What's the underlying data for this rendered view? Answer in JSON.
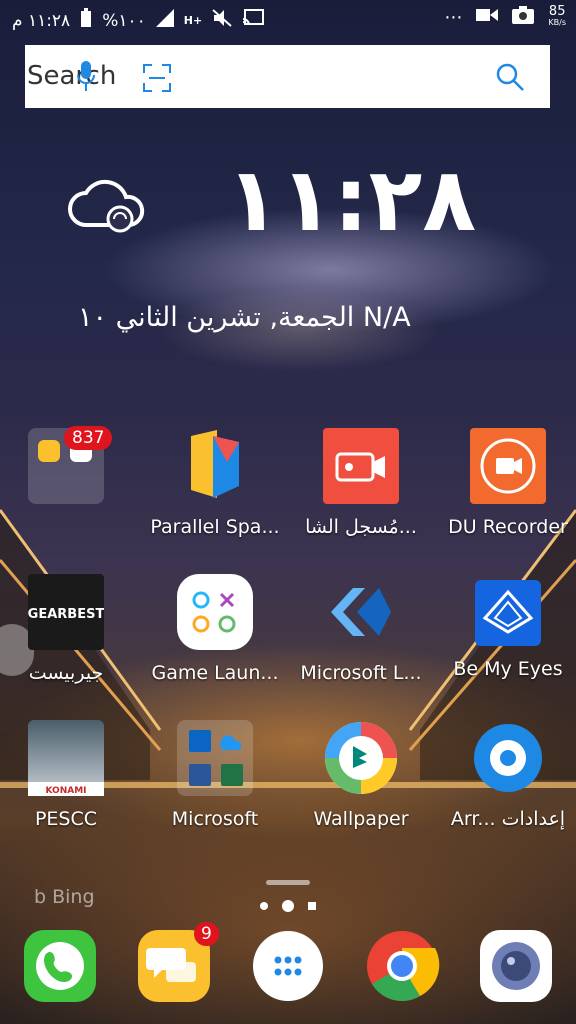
{
  "status_bar": {
    "time": "١١:٢٨ م",
    "battery": "%١٠٠",
    "network_type": "H+",
    "speed_value": "85",
    "speed_unit": "KB/s"
  },
  "search": {
    "label": "Search"
  },
  "clock_widget": {
    "time": "١١:٢٨",
    "date": "الجمعة, تشرين الثاني ١٠ N/A"
  },
  "apps": {
    "folder1": {
      "badge": "837"
    },
    "parallel_space": {
      "label": "Parallel Spa..."
    },
    "screen_recorder_ar": {
      "label": "مُسجل الشا..."
    },
    "du_recorder": {
      "label": "DU Recorder"
    },
    "gearbest": {
      "label": "جيربيست",
      "logo_text": "GEARBEST"
    },
    "game_launcher": {
      "label": "Game Laun..."
    },
    "microsoft_launcher": {
      "label": "Microsoft L..."
    },
    "be_my_eyes": {
      "label": "Be My Eyes"
    },
    "pescc": {
      "label": "PESCC",
      "logo_text": "KONAMI"
    },
    "microsoft_folder": {
      "label": "Microsoft"
    },
    "wallpaper": {
      "label": "Wallpaper"
    },
    "settings": {
      "label": "Arr... إعدادات"
    }
  },
  "bing": {
    "label": "Bing"
  },
  "dock": {
    "messages_badge": "9"
  },
  "colors": {
    "du_orange": "#f26a2e",
    "recorder_red": "#f04e3e",
    "badge_red": "#e0141c",
    "phone_green": "#3ec43e",
    "messages_yellow": "#fbc02d",
    "settings_blue": "#1e88e5",
    "bemyeyes_blue": "#1565e0"
  }
}
